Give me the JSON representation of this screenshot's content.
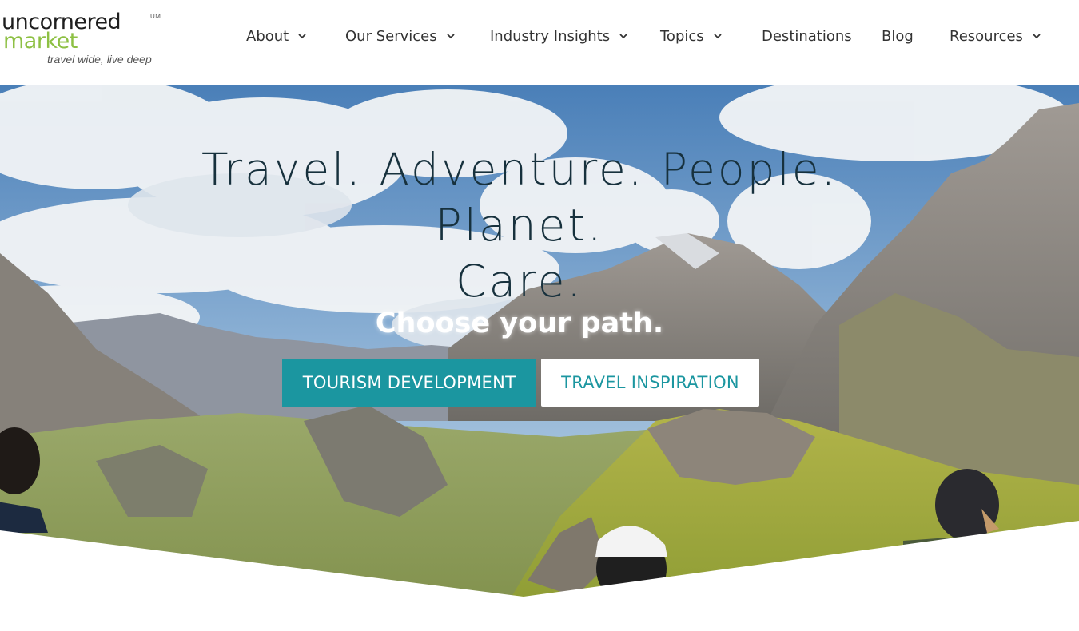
{
  "logo": {
    "line1": "uncornered",
    "line2": "market",
    "mark": "UM",
    "tagline": "travel wide, live deep"
  },
  "nav": {
    "about": "About",
    "services": "Our Services",
    "insights": "Industry Insights",
    "topics": "Topics",
    "destinations": "Destinations",
    "blog": "Blog",
    "resources": "Resources"
  },
  "hero": {
    "headline_line1": "Travel. Adventure. People. Planet.",
    "headline_line2": "Care.",
    "subhead": "Choose your path.",
    "primary_button": "TOURISM DEVELOPMENT",
    "secondary_button": "TRAVEL INSPIRATION"
  },
  "colors": {
    "accent": "#1b96a0",
    "logo_green": "#8dc043",
    "headline": "#17313d"
  },
  "icons": [
    "chevron-down-icon",
    "cap-icon",
    "person-icon"
  ]
}
